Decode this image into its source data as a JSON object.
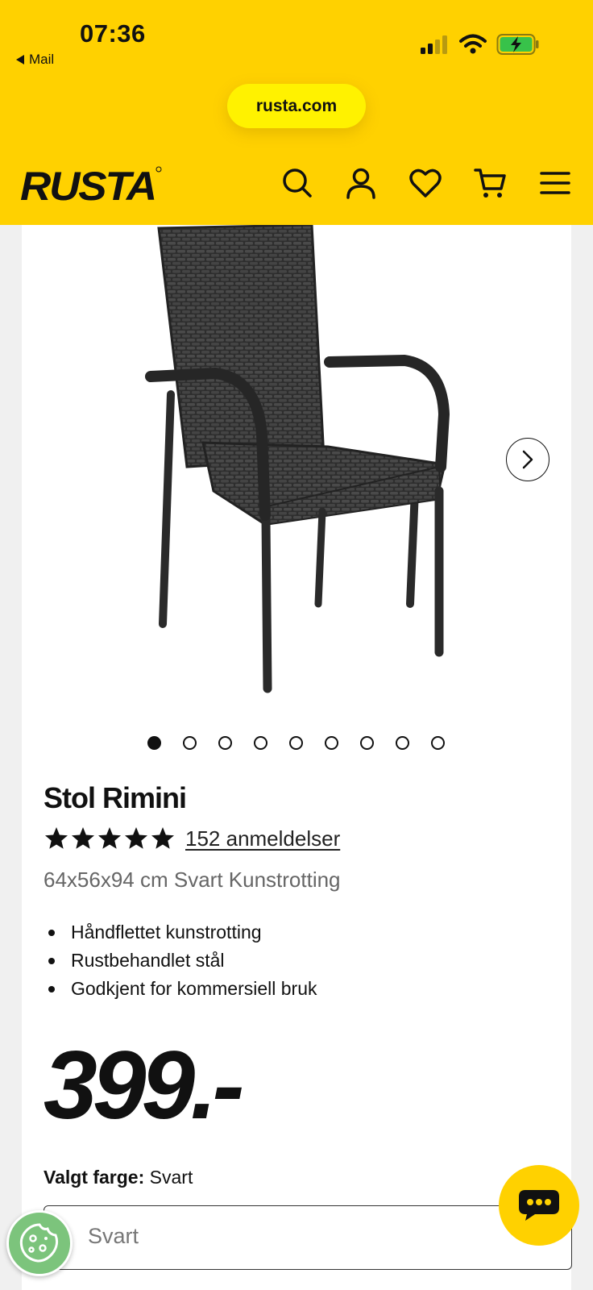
{
  "status_bar": {
    "time": "07:36",
    "back_app": "Mail",
    "icons": [
      "signal-icon",
      "wifi-icon",
      "battery-charging-icon"
    ],
    "battery_color": "#38c24a"
  },
  "browser": {
    "url": "rusta.com"
  },
  "header": {
    "logo_text": "RUSTA",
    "brand_color": "#ffd100",
    "nav_icons": [
      "search-icon",
      "account-icon",
      "wishlist-heart-icon",
      "cart-icon",
      "menu-icon"
    ]
  },
  "product": {
    "image_icon": "chair-photo",
    "carousel": {
      "total": 9,
      "active": 1
    },
    "title": "Stol Rimini",
    "rating": {
      "stars": 5,
      "max": 5
    },
    "reviews_label": "152 anmeldelser",
    "subtitle": "64x56x94 cm Svart Kunstrotting",
    "features": [
      "Håndflettet kunstrotting",
      "Rustbehandlet stål",
      "Godkjent for kommersiell bruk"
    ],
    "price": "399.-",
    "color_label": "Valgt farge:",
    "color_value": "Svart",
    "color_select": {
      "selected": "Svart"
    }
  },
  "floating": {
    "chat_icon": "chat-bubble-icon",
    "cookie_icon": "cookie-icon"
  }
}
